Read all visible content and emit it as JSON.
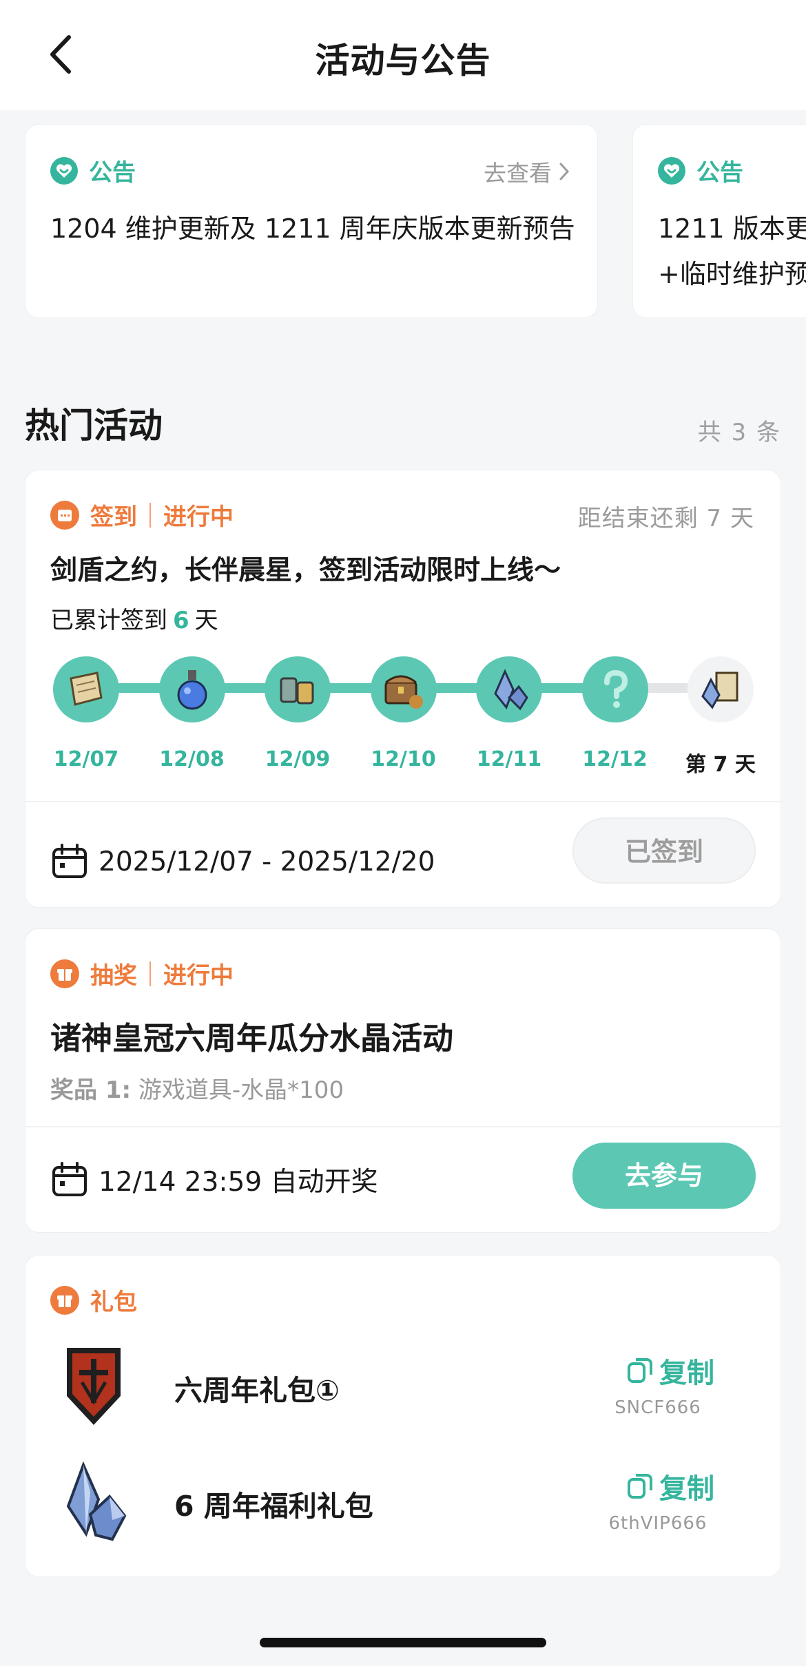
{
  "header": {
    "title": "活动与公告"
  },
  "announcements": [
    {
      "tag": "公告",
      "link": "去查看",
      "text": "1204 维护更新及 1211 周年庆版本更新预告"
    },
    {
      "tag": "公告",
      "text": "1211 版本更\n+临时维护预"
    }
  ],
  "section": {
    "title": "热门活动",
    "count": "共 3 条"
  },
  "checkin": {
    "tag": "签到",
    "status": "进行中",
    "remain": "距结束还剩 7 天",
    "title": "剑盾之约，长伴晨星，签到活动限时上线～",
    "sub_prefix": "已累计签到",
    "sub_count": "6",
    "sub_suffix": "天",
    "days": [
      "12/07",
      "12/08",
      "12/09",
      "12/10",
      "12/11",
      "12/12",
      "第 7 天"
    ],
    "day_icons": [
      "scroll-icon",
      "potion-icon",
      "items-icon",
      "chest-icon",
      "crystal-icon",
      "mystery-icon",
      "crystal-book-icon"
    ],
    "period": "2025/12/07 - 2025/12/20",
    "button": "已签到"
  },
  "lottery": {
    "tag": "抽奖",
    "status": "进行中",
    "title": "诸神皇冠六周年瓜分水晶活动",
    "prize_label": "奖品 1:",
    "prize_value": "游戏道具-水晶*100",
    "draw_time": "12/14 23:59 自动开奖",
    "button": "去参与"
  },
  "gifts": {
    "tag": "礼包",
    "items": [
      {
        "name": "六周年礼包①",
        "copy": "复制",
        "code": "SNCF666",
        "icon": "shield-icon"
      },
      {
        "name": "6 周年福利礼包",
        "copy": "复制",
        "code": "6thVIP666",
        "icon": "crystal-icon"
      }
    ]
  },
  "colors": {
    "accent": "#35b59d",
    "accent_light": "#5cc8b3",
    "orange": "#ee7b3c"
  }
}
